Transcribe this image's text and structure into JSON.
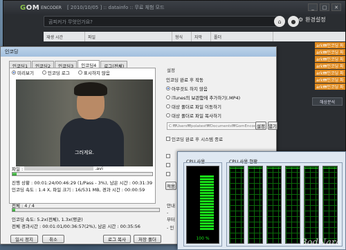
{
  "gom": {
    "logo_g": "G",
    "logo_om": "OM",
    "logo_encoder": "ENCODER",
    "window_title": "[ 2010/10/05 ] :: datainfo :: 무료 체험 모드",
    "search_placeholder": "곰피커가 무엇인가요?",
    "settings_label": "환경설정",
    "table_headers": [
      "재생 시간",
      "파일",
      "형식",
      "자막",
      "폴더"
    ],
    "queue_rows": [
      "ark₩인코딩 파",
      "ark₩인코딩 파",
      "ark₩인코딩 파",
      "ark₩인코딩 파",
      "ark₩인코딩 파",
      "ark₩인코딩 파",
      "ark₩인코딩 파"
    ],
    "analyze_button": "해상분석"
  },
  "dialog": {
    "title": "인코딩",
    "tabs": [
      "인코딩1",
      "인코딩2",
      "인코딩3",
      "인코딩4",
      "로그(전체)"
    ],
    "active_tab": 3,
    "preview_options": [
      "미리보기",
      "인코딩 로그",
      "표시하지 않음"
    ],
    "subtitle": "그러게요.",
    "file_label": "파일 :",
    "file_ext": ".avi",
    "progress_status": "진행 상황 : 00:01:24/00:46:29 (1/Pass - 3%), 남은 시간 : 00:31:39",
    "speed_status": "인코딩 속도 : 1.4 X, 파일 크기 : 16/531 MB, 경과 시간 : 00:00:59",
    "file_progress_pct": 3,
    "total_label": "전체 : 4 / 4",
    "total_progress_pct": 2,
    "total_speed": "인코딩 속도: 5.2x(전체), 1.3x(평균)",
    "total_time": "전체 경과시간 : 00:01:01/00:36:57(2%), 남은 시간 : 00:35:56",
    "pause_button": "일시 정지",
    "cancel_button": "취소",
    "copy_log_button": "로그 복사",
    "open_folder_button": "저장 폴더"
  },
  "settings": {
    "section": "설정",
    "group_label": "인코딩 완료 후 작동",
    "options": [
      "아무것도 하지 않음",
      "iTunes의 보관함에 추가하기(.MP4)",
      "대상 폴더로 파일 이동하기",
      "대상 폴더로 파일 복사하기"
    ],
    "selected_option": 0,
    "path": "C:₩Users₩polatest₩Documents₩GomEncod",
    "path_set": "설정",
    "path_open": "열기",
    "shutdown_label": "인코딩 완료 후 시스템 종료",
    "frag_apply": "적용",
    "frag_guide": "안내",
    "frag_bu": "부터",
    "frag_line": "-",
    "frag_in": "- 인"
  },
  "cpu": {
    "usage_label": "CPU 사용",
    "history_label": "CPU 사용 현황",
    "usage_value": "100 %",
    "usage_pct": 100,
    "core_count": 6
  },
  "watermark": "BodNara"
}
